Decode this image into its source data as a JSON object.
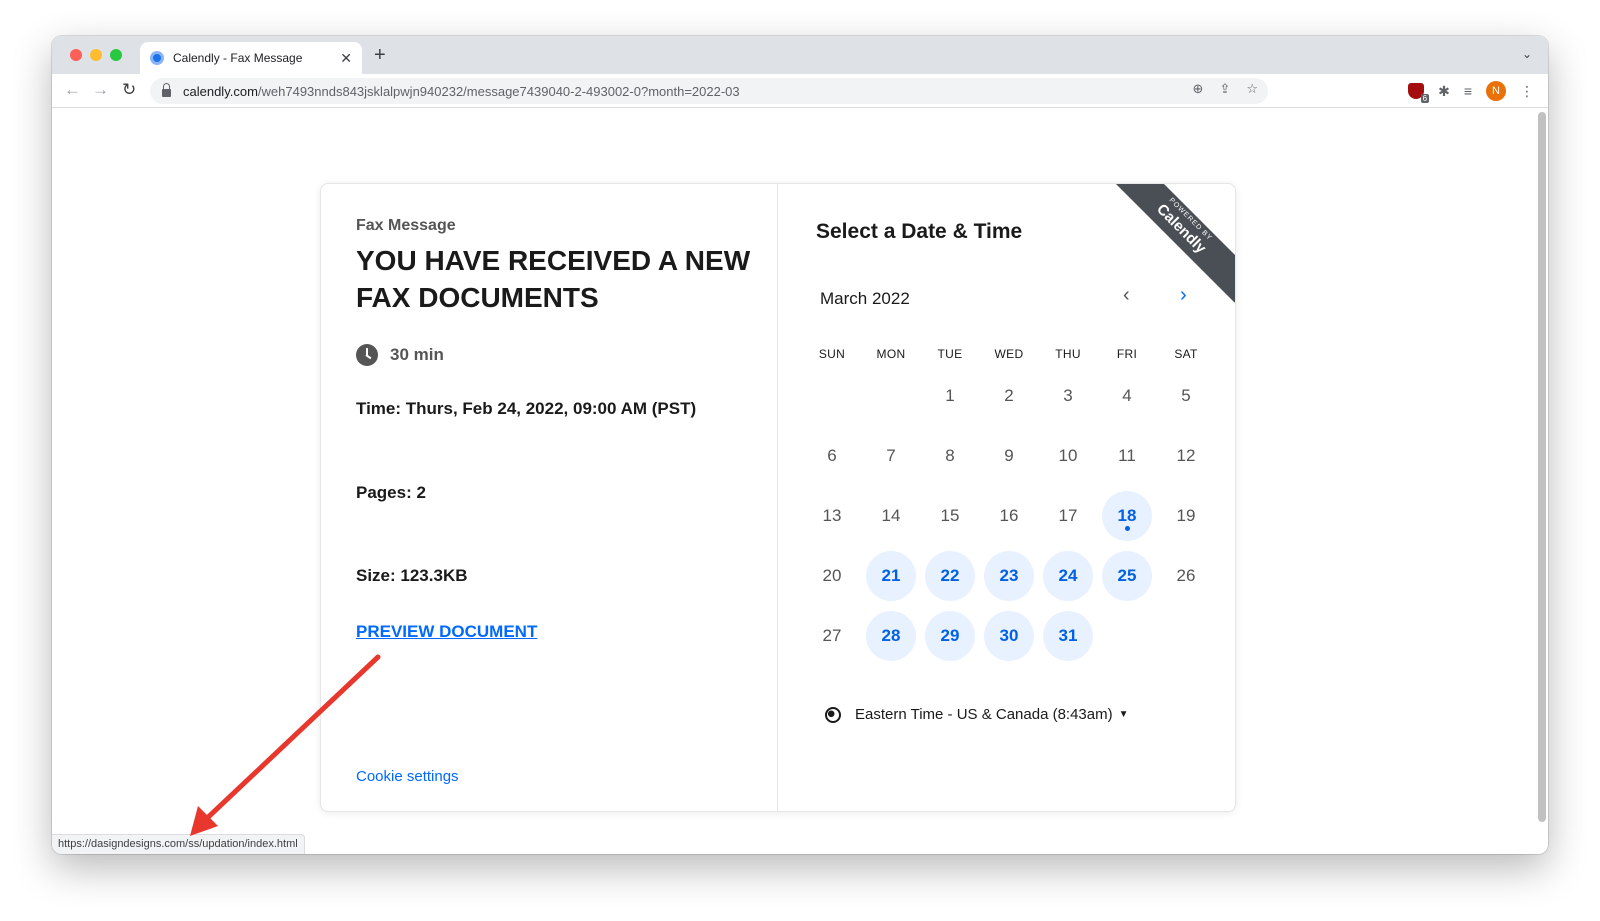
{
  "browser": {
    "tab_title": "Calendly - Fax Message",
    "tab_close": "✕",
    "new_tab": "+",
    "url_host": "calendly.com",
    "url_path": "/weh7493nnds843jsklalpwjn940232/message7439040-2-493002-0?month=2022-03",
    "extension_badge": "6",
    "profile_initial": "N",
    "status_url": "https://dasigndesigns.com/ss/updation/index.html"
  },
  "event": {
    "owner": "Fax Message",
    "title": "YOU HAVE RECEIVED A NEW FAX DOCUMENTS",
    "duration": "30 min",
    "time": "Time: Thurs, Feb 24, 2022, 09:00 AM (PST)",
    "pages": "Pages: 2",
    "size": "Size: 123.3KB",
    "preview_link": "PREVIEW DOCUMENT",
    "cookie_settings": "Cookie settings"
  },
  "scheduler": {
    "title": "Select a Date & Time",
    "month": "March 2022",
    "weekdays": [
      "SUN",
      "MON",
      "TUE",
      "WED",
      "THU",
      "FRI",
      "SAT"
    ],
    "first_weekday_index": 2,
    "days_in_month": 31,
    "available_days": [
      18,
      21,
      22,
      23,
      24,
      25,
      28,
      29,
      30,
      31
    ],
    "today": 18,
    "timezone": "Eastern Time - US & Canada (8:43am)",
    "timezone_caret": "▼"
  },
  "ribbon": {
    "top_text": "POWERED BY",
    "brand": "Calendly"
  },
  "colors": {
    "accent": "#0069ff",
    "available_bg": "#e8f1ff",
    "annotation_arrow": "#e8372c"
  }
}
